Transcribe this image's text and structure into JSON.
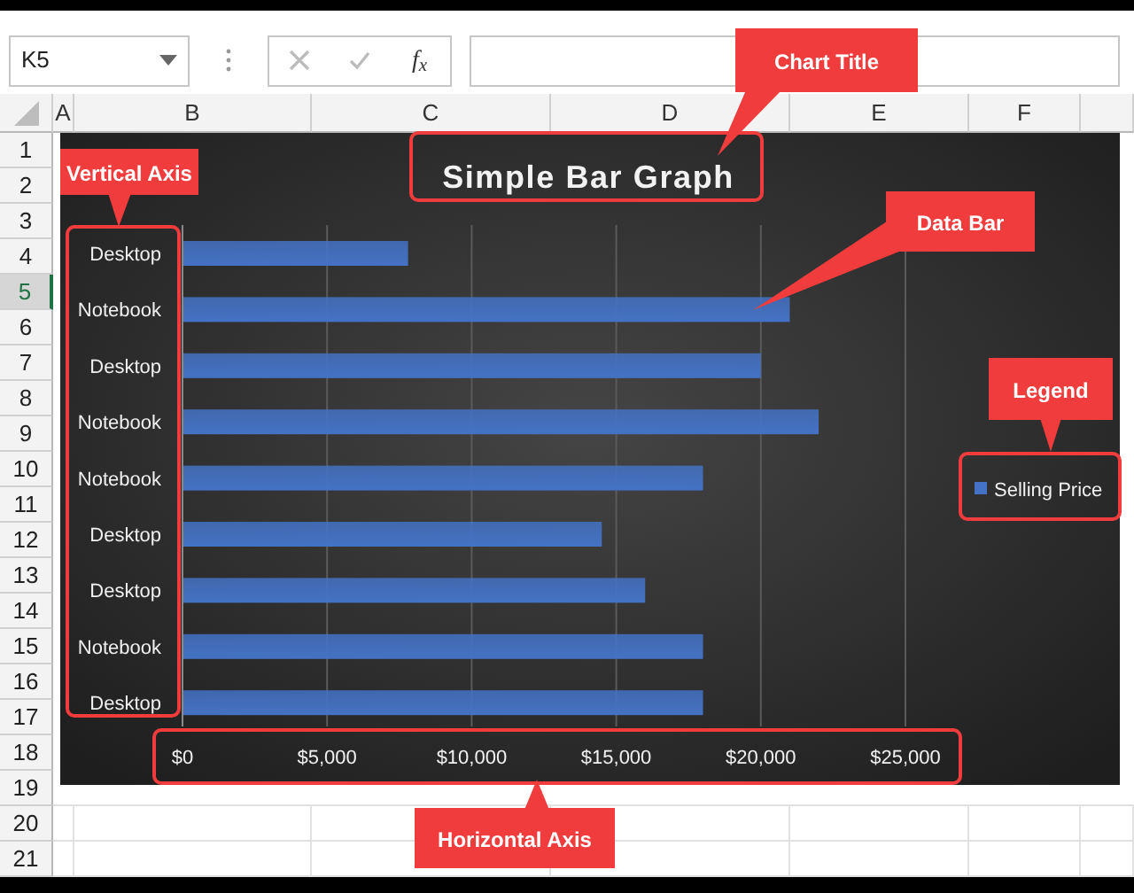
{
  "formula_bar": {
    "name_box": "K5",
    "function_button": "f$_{x}$"
  },
  "columns": [
    {
      "label": "A"
    },
    {
      "label": "B"
    },
    {
      "label": "C"
    },
    {
      "label": "D"
    },
    {
      "label": "E"
    },
    {
      "label": "F"
    }
  ],
  "rows": [
    {
      "label": "1",
      "selected": false
    },
    {
      "label": "2",
      "selected": false
    },
    {
      "label": "3",
      "selected": false
    },
    {
      "label": "4",
      "selected": false
    },
    {
      "label": "5",
      "selected": true
    },
    {
      "label": "6",
      "selected": false
    },
    {
      "label": "7",
      "selected": false
    },
    {
      "label": "8",
      "selected": false
    },
    {
      "label": "9",
      "selected": false
    },
    {
      "label": "10",
      "selected": false
    },
    {
      "label": "11",
      "selected": false
    },
    {
      "label": "12",
      "selected": false
    },
    {
      "label": "13",
      "selected": false
    },
    {
      "label": "14",
      "selected": false
    },
    {
      "label": "15",
      "selected": false
    },
    {
      "label": "16",
      "selected": false
    },
    {
      "label": "17",
      "selected": false
    },
    {
      "label": "18",
      "selected": false
    },
    {
      "label": "19",
      "selected": false
    },
    {
      "label": "20",
      "selected": false
    },
    {
      "label": "21",
      "selected": false
    }
  ],
  "chart": {
    "chart_data": {
      "type": "bar",
      "orientation": "horizontal",
      "title": "Simple Bar Graph",
      "categories": [
        "Desktop",
        "Notebook",
        "Desktop",
        "Notebook",
        "Notebook",
        "Desktop",
        "Desktop",
        "Notebook",
        "Desktop"
      ],
      "series": [
        {
          "name": "Selling Price",
          "color": "#4472c4",
          "values": [
            7800,
            21000,
            20000,
            22000,
            18000,
            14500,
            16000,
            18000,
            18000
          ]
        }
      ],
      "xlim": [
        0,
        25000
      ],
      "grid": true,
      "xticks": [
        {
          "value": 0,
          "label": "$0"
        },
        {
          "value": 5000,
          "label": "$5,000"
        },
        {
          "value": 10000,
          "label": "$10,000"
        },
        {
          "value": 15000,
          "label": "$15,000"
        },
        {
          "value": 20000,
          "label": "$20,000"
        },
        {
          "value": 25000,
          "label": "$25,000"
        }
      ]
    }
  },
  "callouts": [
    {
      "label": "Chart Title",
      "kind": "title"
    },
    {
      "label": "Vertical Axis",
      "kind": "yaxis"
    },
    {
      "label": "Data Bar",
      "kind": "bar"
    },
    {
      "label": "Legend",
      "kind": "legend"
    },
    {
      "label": "Horizontal Axis",
      "kind": "xaxis"
    }
  ]
}
